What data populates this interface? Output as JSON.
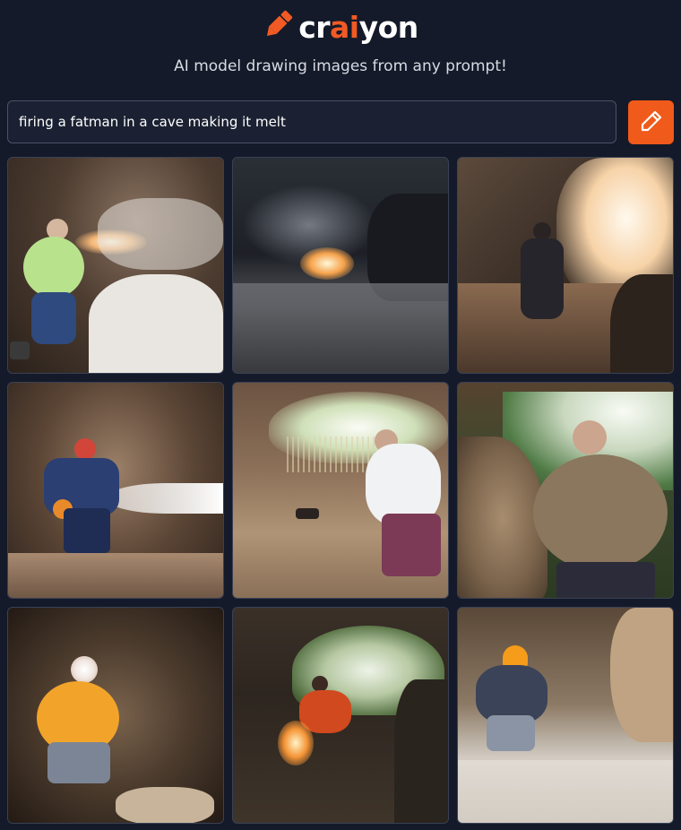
{
  "brand": {
    "prefix": "cr",
    "highlight": "ai",
    "suffix": "yon",
    "tagline": "AI model drawing images from any prompt!",
    "accent": "#f15a24"
  },
  "prompt": {
    "value": "firing a fatman in a cave making it melt",
    "draw_icon": "pencil-icon"
  },
  "results": {
    "count": 9,
    "columns": 3,
    "tiles": [
      {
        "id": "result-1",
        "scene": "man in green shirt and jeans in cave firing flame beside white rock"
      },
      {
        "id": "result-2",
        "scene": "dark cave with bright flame burst and figure on right"
      },
      {
        "id": "result-3",
        "scene": "dark figure in cave with bright light behind"
      },
      {
        "id": "result-4",
        "scene": "man in blue jacket and red hat firing beam in cave"
      },
      {
        "id": "result-5",
        "scene": "fat man in white shirt and purple pants in cave entrance"
      },
      {
        "id": "result-6",
        "scene": "fat man in brown shirt beside cave rock and greenery"
      },
      {
        "id": "result-7",
        "scene": "fat man in orange shirt and headlamp in cave"
      },
      {
        "id": "result-8",
        "scene": "man holding glowing flame at cave entrance"
      },
      {
        "id": "result-9",
        "scene": "fat man in orange helmet standing in pale cave"
      }
    ]
  }
}
